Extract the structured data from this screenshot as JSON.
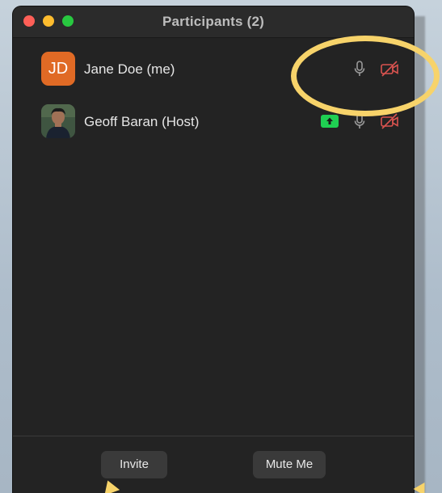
{
  "window": {
    "title": "Participants (2)"
  },
  "participants": [
    {
      "name": "Jane Doe (me)",
      "initials": "JD",
      "avatar_color": "#e06a25",
      "icons": [
        "mic-icon",
        "camera-off-icon"
      ]
    },
    {
      "name": "Geoff Baran (Host)",
      "initials": "",
      "avatar": "photo",
      "icons": [
        "screen-share-icon",
        "mic-icon",
        "camera-off-icon"
      ]
    }
  ],
  "footer": {
    "invite_label": "Invite",
    "mute_me_label": "Mute Me"
  },
  "colors": {
    "window_bg": "#232323",
    "camera_off": "#d9534f",
    "share_green": "#1fcf52",
    "highlight": "#f7d36a"
  }
}
